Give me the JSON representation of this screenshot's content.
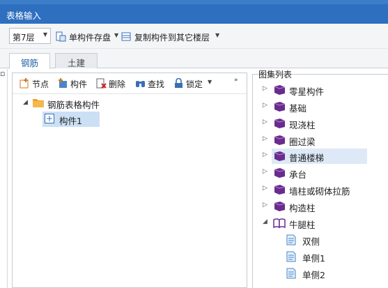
{
  "window": {
    "title": "表格输入"
  },
  "toolbar": {
    "floor_select": "第7层",
    "save_label": "单构件存盘",
    "copy_label": "复制构件到其它楼层"
  },
  "tabs": [
    {
      "label": "钢筋",
      "active": true
    },
    {
      "label": "土建",
      "active": false
    }
  ],
  "left_toolbar": {
    "node": "节点",
    "component": "构件",
    "delete": "删除",
    "find": "查找",
    "lock": "锁定"
  },
  "tree": {
    "root": "钢筋表格构件",
    "child": "构件1"
  },
  "atlas": {
    "title": "图集列表",
    "items": [
      {
        "label": "零星构件",
        "expanded": false
      },
      {
        "label": "基础",
        "expanded": false
      },
      {
        "label": "现浇柱",
        "expanded": false
      },
      {
        "label": "圈过梁",
        "expanded": false
      },
      {
        "label": "普通楼梯",
        "expanded": false,
        "selected": true
      },
      {
        "label": "承台",
        "expanded": false
      },
      {
        "label": "墙柱或砌体拉筋",
        "expanded": false
      },
      {
        "label": "构造柱",
        "expanded": false
      },
      {
        "label": "牛腿柱",
        "expanded": true
      }
    ],
    "sub_items": [
      "双侧",
      "单侧1",
      "单侧2"
    ]
  },
  "colors": {
    "titlebar": "#2e6fbf",
    "selection": "#cce0f5",
    "book": "#6a2b8f"
  }
}
